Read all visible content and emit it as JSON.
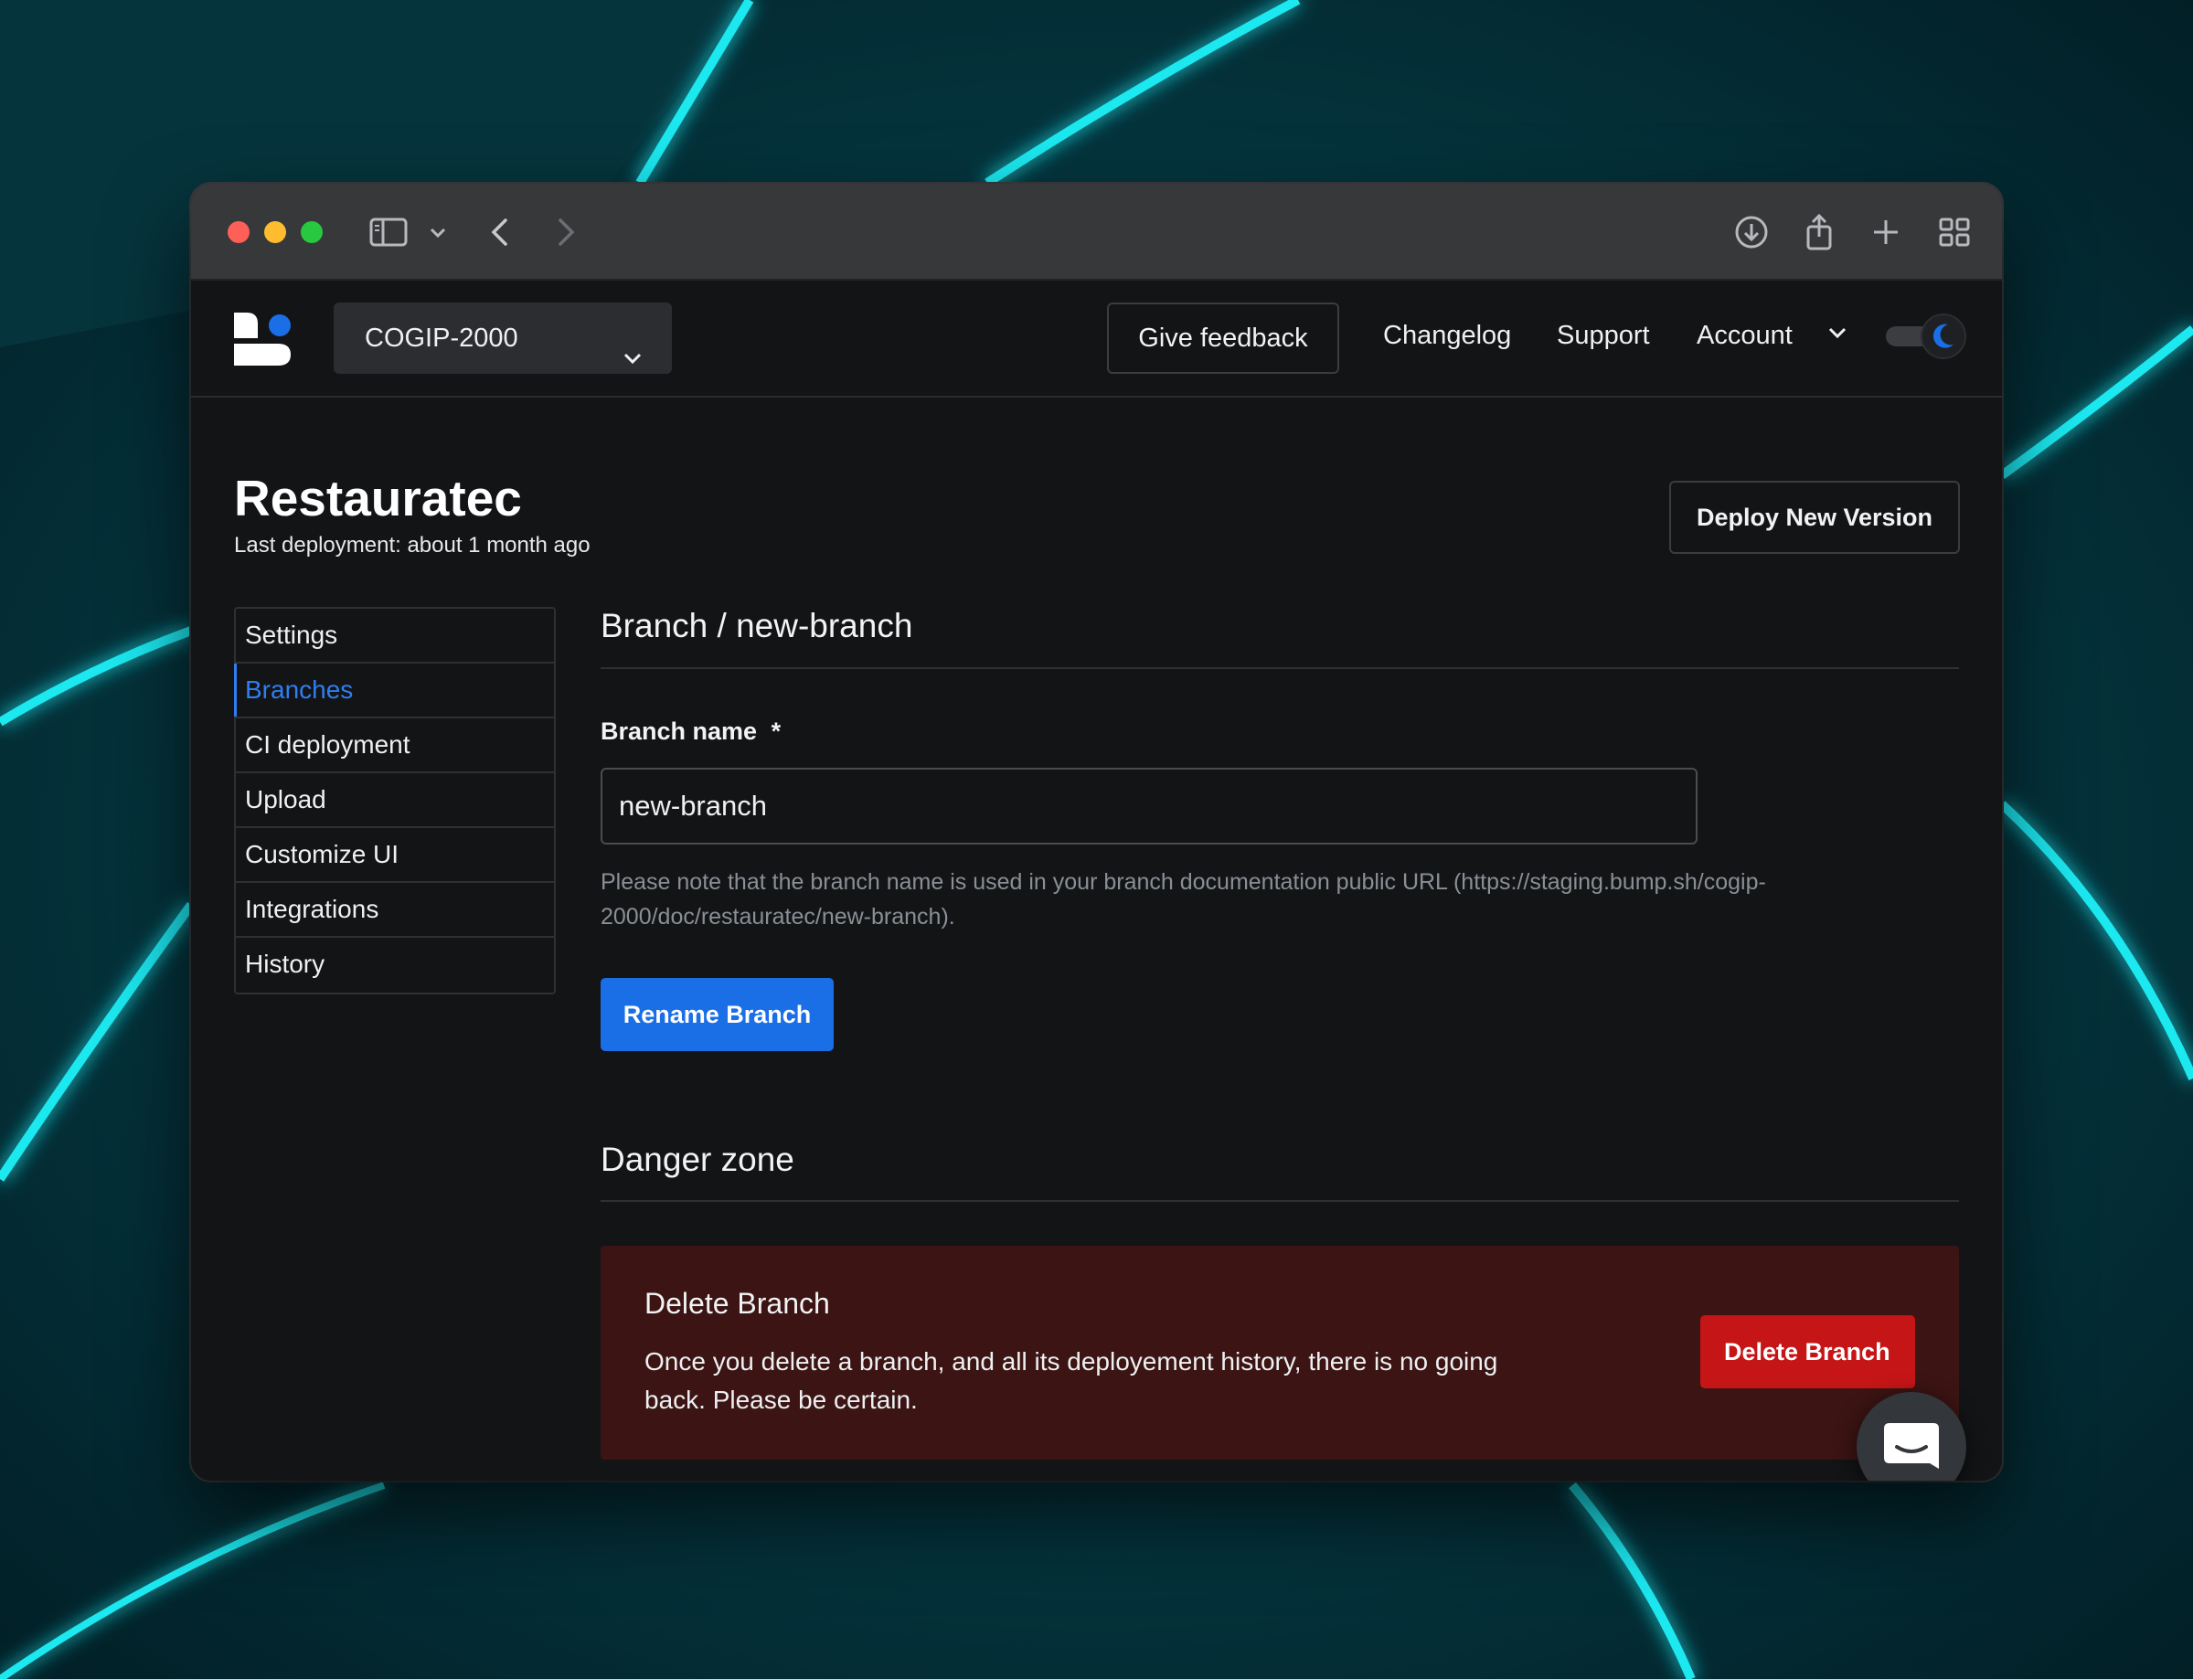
{
  "org_selector": {
    "value": "COGIP-2000"
  },
  "nav": {
    "feedback_label": "Give feedback",
    "changelog_label": "Changelog",
    "support_label": "Support",
    "account_label": "Account"
  },
  "project": {
    "title": "Restauratec",
    "last_deployment": "Last deployment: about 1 month ago",
    "deploy_button": "Deploy New Version"
  },
  "sidebar": {
    "items": [
      {
        "label": "Settings"
      },
      {
        "label": "Branches"
      },
      {
        "label": "CI deployment"
      },
      {
        "label": "Upload"
      },
      {
        "label": "Customize UI"
      },
      {
        "label": "Integrations"
      },
      {
        "label": "History"
      }
    ],
    "active": "Branches"
  },
  "branch_form": {
    "heading": "Branch / new-branch",
    "label": "Branch name",
    "required_mark": "*",
    "value": "new-branch",
    "help": "Please note that the branch name is used in your branch documentation public URL (https://staging.bump.sh/cogip-2000/doc/restauratec/new-branch).",
    "rename_button": "Rename Branch"
  },
  "danger_zone": {
    "heading": "Danger zone",
    "title": "Delete Branch",
    "description": "Once you delete a branch, and all its deployement history, there is no going back. Please be certain.",
    "delete_button": "Delete Branch"
  },
  "colors": {
    "accent": "#1a6ee6",
    "danger": "#c51517",
    "danger_bg": "#3b1413",
    "background": "#131416"
  }
}
